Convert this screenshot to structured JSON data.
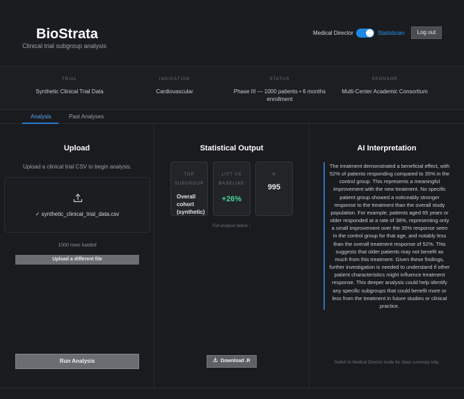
{
  "header": {
    "brand": "BioStrata",
    "tagline": "Clinical trial subgroup analysis",
    "mode_left": "Medical Director",
    "mode_right": "Statistician",
    "toggle_on": true,
    "logout_label": "Log out",
    "accent_color": "#1e88e5"
  },
  "info": [
    {
      "label": "TRIAL",
      "value": "Synthetic Clinical Trial Data"
    },
    {
      "label": "INDICATION",
      "value": "Cardiovascular"
    },
    {
      "label": "STATUS",
      "value": "Phase III — 1000 patients • 6 months enrollment"
    },
    {
      "label": "SPONSOR",
      "value": "Multi-Center Academic Consortium"
    }
  ],
  "tabs": [
    {
      "label": "Analysis",
      "active": true
    },
    {
      "label": "Past Analyses",
      "active": false
    }
  ],
  "upload": {
    "title": "Upload",
    "hint": "Upload a clinical trial CSV to begin analysis.",
    "icon": "upload-icon",
    "file_name": "✓ synthetic_clinical_trial_data.csv",
    "rows_loaded": "1000 rows loaded",
    "change_label": "Upload a different file",
    "run_label": "Run Analysis"
  },
  "stats": {
    "title": "Statistical Output",
    "cards": [
      {
        "label": "TOP SUBGROUP",
        "value": "Overall cohort (synthetic)"
      },
      {
        "label": "LIFT VS BASELINE",
        "value": "+26%",
        "color": "#4bd29a"
      },
      {
        "label": "N",
        "value": "995"
      }
    ],
    "full_analysis_note": "Full analysis below ↓",
    "download_label": "Download .R"
  },
  "interpretation": {
    "title": "AI Interpretation",
    "text": "The treatment demonstrated a beneficial effect, with 52% of patients responding compared to 35% in the control group. This represents a meaningful improvement with the new treatment. No specific patient group showed a noticeably stronger response to the treatment than the overall study population. For example, patients aged 65 years or older responded at a rate of 38%, representing only a small improvement over the 35% response seen in the control group for that age, and notably less than the overall treatment response of 52%. This suggests that older patients may not benefit as much from this treatment. Given these findings, further investigation is needed to understand if other patient characteristics might influence treatment response. This deeper analysis could help identify any specific subgroups that could benefit more or less from the treatment in future studies or clinical practice.",
    "switch_note": "Switch to Medical Director mode for clean summary only."
  }
}
